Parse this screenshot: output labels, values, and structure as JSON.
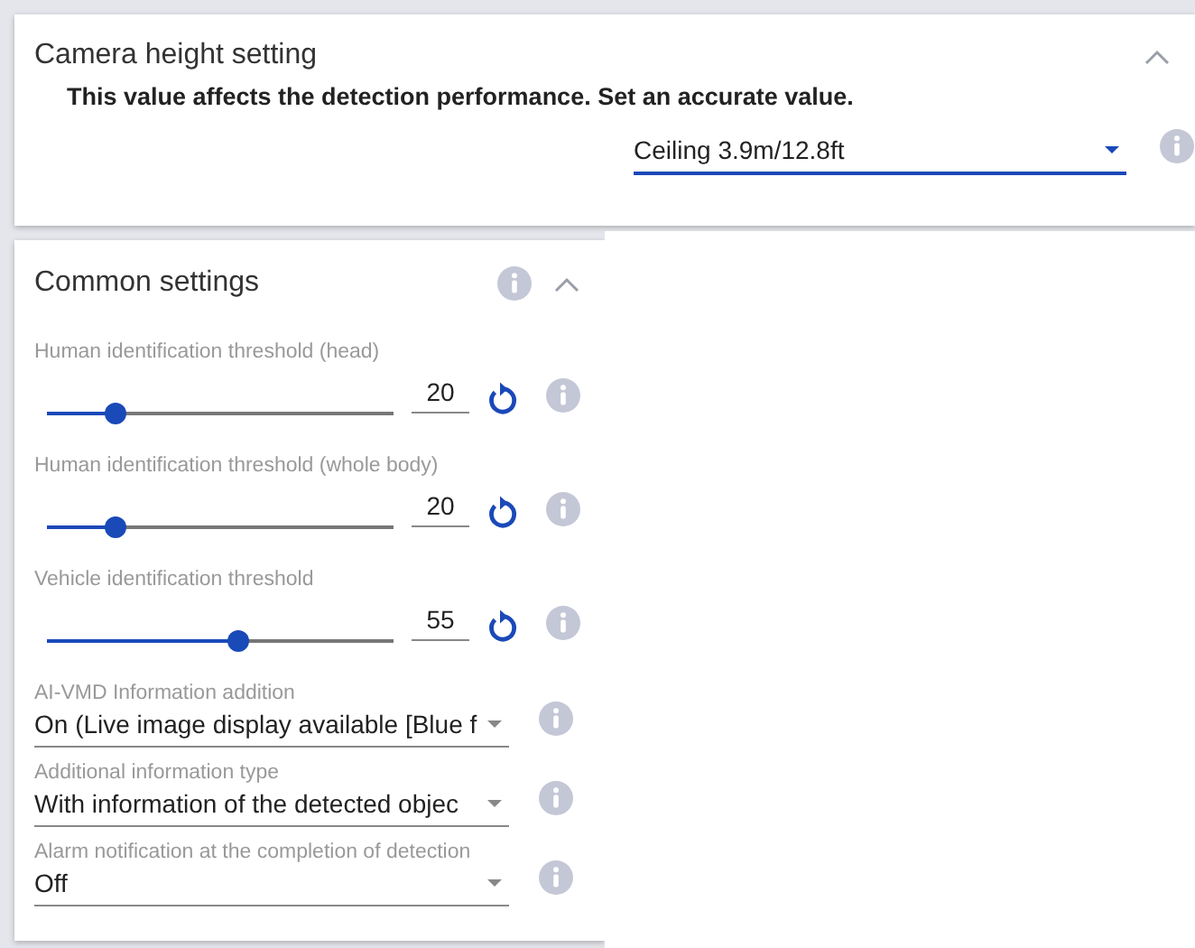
{
  "camera_height": {
    "title": "Camera height setting",
    "expanded": true,
    "notice": "This value affects the detection performance. Set an accurate value.",
    "select": {
      "value": "Ceiling 3.9m/12.8ft",
      "focused": true
    }
  },
  "common_settings": {
    "title": "Common settings",
    "expanded": true,
    "items": [
      {
        "kind": "slider",
        "label": "Human identification threshold (head)",
        "level": 0.2,
        "value": "20"
      },
      {
        "kind": "slider",
        "label": "Human identification threshold (whole body)",
        "level": 0.2,
        "value": "20"
      },
      {
        "kind": "slider",
        "label": "Vehicle identification threshold",
        "level": 0.55,
        "value": "55"
      },
      {
        "kind": "select",
        "label": "AI-VMD Information addition",
        "value": "On (Live image display available [Blue f",
        "focused": false
      },
      {
        "kind": "select",
        "label": "Additional information type",
        "value": "With information of the detected objec",
        "focused": false
      },
      {
        "kind": "select",
        "label": "Alarm notification at the completion of detection",
        "value": "Off",
        "focused": false
      }
    ]
  }
}
